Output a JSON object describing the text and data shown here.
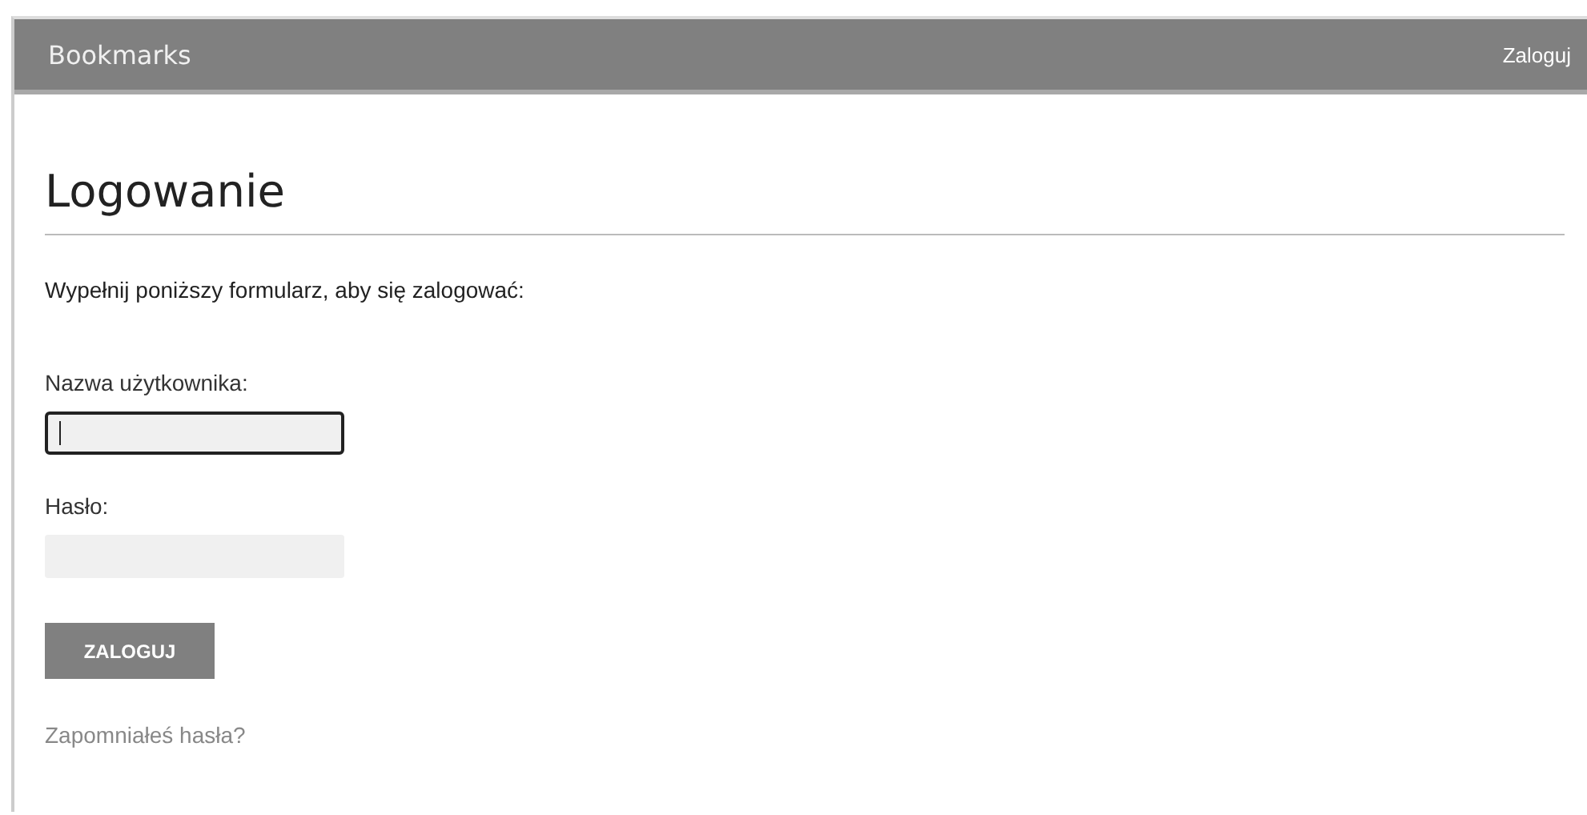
{
  "navbar": {
    "brand": "Bookmarks",
    "login_link": "Zaloguj"
  },
  "heading": "Logowanie",
  "intro": "Wypełnij poniższy formularz, aby się zalogować:",
  "fields": [
    {
      "label": "Nazwa użytkownika:",
      "focused": true
    },
    {
      "label": "Hasło:",
      "focused": false
    }
  ],
  "submit_button": "ZALOGUJ",
  "forgot_link": "Zapomniałeś hasła?"
}
